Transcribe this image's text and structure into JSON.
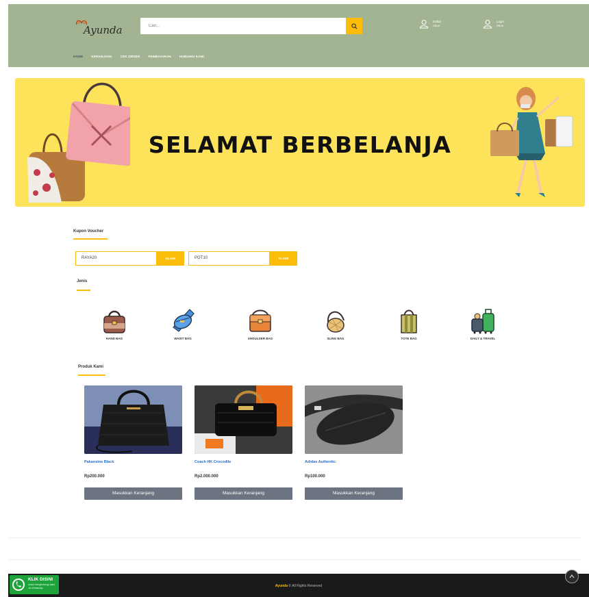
{
  "header": {
    "logo_text": "Ayunda",
    "search": {
      "placeholder": "Cari..."
    },
    "account": [
      {
        "line1": "Daftar",
        "line2": "Akun"
      },
      {
        "line1": "Login",
        "line2": "Akun"
      }
    ],
    "nav": [
      {
        "label": "HOME",
        "active": true
      },
      {
        "label": "KERANJANG",
        "active": false
      },
      {
        "label": "CEK ORDER",
        "active": false
      },
      {
        "label": "PEMBAYARAN",
        "active": false
      },
      {
        "label": "HUBUNGI KAMI",
        "active": false
      }
    ]
  },
  "banner": {
    "title": "SELAMAT BERBELANJA"
  },
  "voucher": {
    "title": "Kupon Voucher",
    "items": [
      {
        "code": "RAYA20",
        "button": "KLAIM"
      },
      {
        "code": "POT10",
        "button": "KLAIM"
      }
    ]
  },
  "categories": {
    "title": "Jenis",
    "items": [
      {
        "label": "HAND BAG",
        "icon": "handbag-icon"
      },
      {
        "label": "WAIST BAG",
        "icon": "waist-bag-icon"
      },
      {
        "label": "SHOULDER BAG",
        "icon": "shoulder-bag-icon"
      },
      {
        "label": "SLING BAG",
        "icon": "sling-bag-icon"
      },
      {
        "label": "TOTE BAG",
        "icon": "tote-bag-icon"
      },
      {
        "label": "DAILY & TRAVEL",
        "icon": "luggage-icon"
      }
    ]
  },
  "products": {
    "title": "Produk Kami",
    "items": [
      {
        "name": "Pakansine Black",
        "price": "Rp200.000",
        "button": "Masukkan Keranjang"
      },
      {
        "name": "Coach HK Crocodile",
        "price": "Rp2.000.000",
        "button": "Masukkan Keranjang"
      },
      {
        "name": "Adidas Authentic",
        "price": "Rp100.000",
        "button": "Masukkan Keranjang"
      }
    ]
  },
  "whatsapp": {
    "title": "KLIK DISINI",
    "subtitle": "untuk menghubungi kami via WhatsApp"
  },
  "footer": {
    "brand": "Ayunda",
    "text": "© All Rights Reserved"
  },
  "colors": {
    "header": "#a2b491",
    "accent": "#fbbd09",
    "banner": "#fde35a",
    "button": "#6b7480",
    "footer": "#1a1a1a"
  }
}
